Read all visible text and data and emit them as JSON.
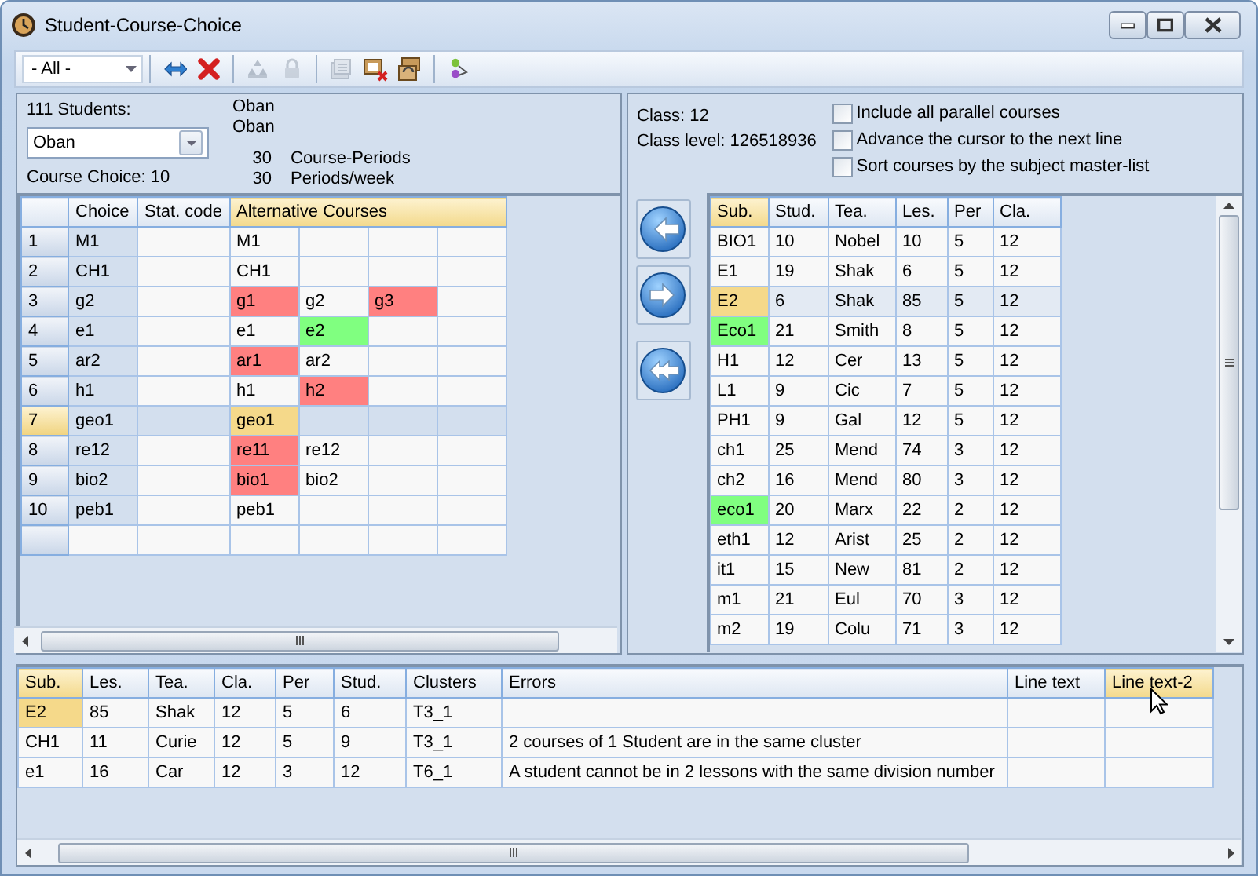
{
  "window": {
    "title": "Student-Course-Choice"
  },
  "toolbar": {
    "filter": "- All -",
    "button_groups": [
      [
        {
          "kind": "swap",
          "disabled": false
        },
        {
          "kind": "delete",
          "disabled": false
        }
      ],
      [
        {
          "kind": "tree",
          "disabled": true
        },
        {
          "kind": "lock",
          "disabled": true
        }
      ],
      [
        {
          "kind": "calendar",
          "disabled": true
        },
        {
          "kind": "tables-remove",
          "disabled": false
        },
        {
          "kind": "tables-refresh",
          "disabled": false
        }
      ],
      [
        {
          "kind": "person",
          "disabled": false
        }
      ]
    ]
  },
  "student_panel": {
    "count_label": "111 Students:",
    "student": "Oban",
    "name_lines": [
      "Oban",
      "Oban"
    ],
    "stats": [
      {
        "value": "30",
        "label": "Course-Periods"
      },
      {
        "value": "30",
        "label": "Periods/week"
      }
    ],
    "course_choice": "Course Choice: 10"
  },
  "choice_grid": {
    "columns": [
      {
        "label": "Choice",
        "highlighted": false
      },
      {
        "label": "Stat. code",
        "highlighted": false
      },
      {
        "label": "Alternative Courses",
        "highlighted": true
      }
    ],
    "rows": [
      {
        "number": "1",
        "choice": "M1",
        "selected": false,
        "alternatives": [
          {
            "course": "M1"
          }
        ]
      },
      {
        "number": "2",
        "choice": "CH1",
        "selected": false,
        "alternatives": [
          {
            "course": "CH1"
          }
        ]
      },
      {
        "number": "3",
        "choice": "g2",
        "selected": false,
        "alternatives": [
          {
            "course": "g1",
            "color": "#ff8080"
          },
          {
            "course": "g2"
          },
          {
            "course": "g3",
            "color": "#ff8080"
          }
        ]
      },
      {
        "number": "4",
        "choice": "e1",
        "selected": false,
        "alternatives": [
          {
            "course": "e1"
          },
          {
            "course": "e2",
            "color": "#80ff80"
          }
        ]
      },
      {
        "number": "5",
        "choice": "ar2",
        "selected": false,
        "alternatives": [
          {
            "course": "ar1",
            "color": "#ff8080"
          },
          {
            "course": "ar2"
          }
        ]
      },
      {
        "number": "6",
        "choice": "h1",
        "selected": false,
        "alternatives": [
          {
            "course": "h1"
          },
          {
            "course": "h2",
            "color": "#ff8080"
          }
        ]
      },
      {
        "number": "7",
        "choice": "geo1",
        "selected": true,
        "alternatives": [
          {
            "course": "geo1",
            "color": "#f5d98a"
          }
        ]
      },
      {
        "number": "8",
        "choice": "re12",
        "selected": false,
        "alternatives": [
          {
            "course": "re11",
            "color": "#ff8080"
          },
          {
            "course": "re12"
          }
        ]
      },
      {
        "number": "9",
        "choice": "bio2",
        "selected": false,
        "alternatives": [
          {
            "course": "bio1",
            "color": "#ff8080"
          },
          {
            "course": "bio2"
          }
        ]
      },
      {
        "number": "10",
        "choice": "peb1",
        "selected": false,
        "alternatives": [
          {
            "course": "peb1"
          }
        ]
      }
    ]
  },
  "class_info": {
    "class": "Class: 12",
    "level": "Class level: 126518936"
  },
  "options": [
    {
      "label": "Include all parallel courses",
      "checked": false
    },
    {
      "label": "Advance the cursor to the next line",
      "checked": false
    },
    {
      "label": "Sort courses by the subject master-list",
      "checked": false
    }
  ],
  "transfer_buttons": [
    {
      "kind": "left"
    },
    {
      "kind": "right"
    },
    {
      "kind": "all-left"
    }
  ],
  "course_list": {
    "columns": [
      {
        "label": "Sub.",
        "highlighted": true
      },
      {
        "label": "Stud.",
        "highlighted": false
      },
      {
        "label": "Tea.",
        "highlighted": false
      },
      {
        "label": "Les.",
        "highlighted": false
      },
      {
        "label": "Per",
        "highlighted": false
      },
      {
        "label": "Cla.",
        "highlighted": false
      }
    ],
    "rows": [
      {
        "subject": "BIO1",
        "students": "10",
        "teacher": "Nobel",
        "lessons": "10",
        "periods": "5",
        "class": "12",
        "selected": false
      },
      {
        "subject": "E1",
        "students": "19",
        "teacher": "Shak",
        "lessons": "6",
        "periods": "5",
        "class": "12",
        "selected": false
      },
      {
        "subject": "E2",
        "students": "6",
        "teacher": "Shak",
        "lessons": "85",
        "periods": "5",
        "class": "12",
        "selected": true
      },
      {
        "subject": "Eco1",
        "students": "21",
        "teacher": "Smith",
        "lessons": "8",
        "periods": "5",
        "class": "12",
        "selected": false,
        "color": "#80ff80"
      },
      {
        "subject": "H1",
        "students": "12",
        "teacher": "Cer",
        "lessons": "13",
        "periods": "5",
        "class": "12",
        "selected": false
      },
      {
        "subject": "L1",
        "students": "9",
        "teacher": "Cic",
        "lessons": "7",
        "periods": "5",
        "class": "12",
        "selected": false
      },
      {
        "subject": "PH1",
        "students": "9",
        "teacher": "Gal",
        "lessons": "12",
        "periods": "5",
        "class": "12",
        "selected": false
      },
      {
        "subject": "ch1",
        "students": "25",
        "teacher": "Mend",
        "lessons": "74",
        "periods": "3",
        "class": "12",
        "selected": false
      },
      {
        "subject": "ch2",
        "students": "16",
        "teacher": "Mend",
        "lessons": "80",
        "periods": "3",
        "class": "12",
        "selected": false
      },
      {
        "subject": "eco1",
        "students": "20",
        "teacher": "Marx",
        "lessons": "22",
        "periods": "2",
        "class": "12",
        "selected": false,
        "color": "#80ff80"
      },
      {
        "subject": "eth1",
        "students": "12",
        "teacher": "Arist",
        "lessons": "25",
        "periods": "2",
        "class": "12",
        "selected": false
      },
      {
        "subject": "it1",
        "students": "15",
        "teacher": "New",
        "lessons": "81",
        "periods": "2",
        "class": "12",
        "selected": false
      },
      {
        "subject": "m1",
        "students": "21",
        "teacher": "Eul",
        "lessons": "70",
        "periods": "3",
        "class": "12",
        "selected": false
      },
      {
        "subject": "m2",
        "students": "19",
        "teacher": "Colu",
        "lessons": "71",
        "periods": "3",
        "class": "12",
        "selected": false
      }
    ]
  },
  "errors_grid": {
    "columns": [
      {
        "label": "Sub.",
        "highlighted": true
      },
      {
        "label": "Les.",
        "highlighted": false
      },
      {
        "label": "Tea.",
        "highlighted": false
      },
      {
        "label": "Cla.",
        "highlighted": false
      },
      {
        "label": "Per",
        "highlighted": false
      },
      {
        "label": "Stud.",
        "highlighted": false
      },
      {
        "label": "Clusters",
        "highlighted": false
      },
      {
        "label": "Errors",
        "highlighted": false
      },
      {
        "label": "Line text",
        "highlighted": false
      },
      {
        "label": "Line text-2",
        "highlighted": true
      }
    ],
    "rows": [
      {
        "subject": "E2",
        "lessons": "85",
        "teacher": "Shak",
        "class": "12",
        "periods": "5",
        "students": "6",
        "clusters": "T3_1",
        "selected": true
      },
      {
        "subject": "CH1",
        "lessons": "11",
        "teacher": "Curie",
        "class": "12",
        "periods": "5",
        "students": "9",
        "clusters": "T3_1",
        "error": "2 courses of 1 Student are in the same cluster",
        "selected": false
      },
      {
        "subject": "e1",
        "lessons": "16",
        "teacher": "Car",
        "class": "12",
        "periods": "3",
        "students": "12",
        "clusters": "T6_1",
        "error": "A student cannot be in 2 lessons with the same division number",
        "selected": false
      }
    ]
  }
}
